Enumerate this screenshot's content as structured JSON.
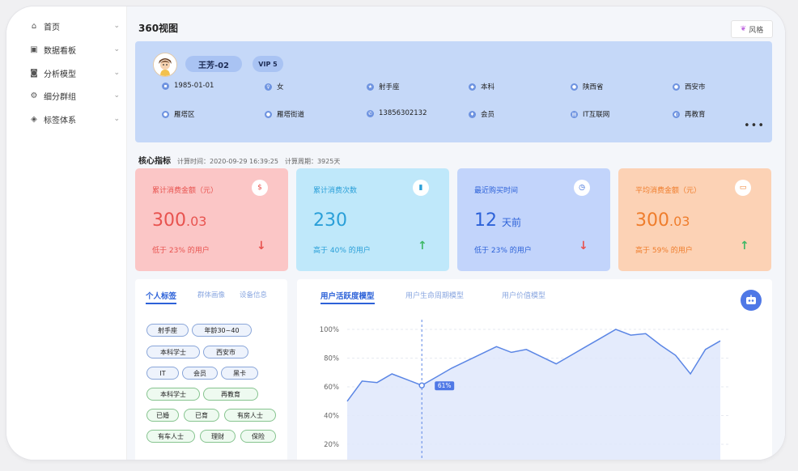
{
  "sidebar": {
    "items": [
      {
        "label": "首页",
        "icon": "home-icon"
      },
      {
        "label": "数据看板",
        "icon": "monitor-icon"
      },
      {
        "label": "分析模型",
        "icon": "model-icon"
      },
      {
        "label": "细分群组",
        "icon": "group-icon"
      },
      {
        "label": "标签体系",
        "icon": "tag-icon"
      }
    ]
  },
  "header": {
    "title": "360视图",
    "style_button": "风格"
  },
  "profile": {
    "name": "王芳-02",
    "vip": "VIP 5",
    "attributes_row1": [
      "1985-01-01",
      "女",
      "射手座",
      "本科",
      "陕西省",
      "西安市"
    ],
    "attributes_row2": [
      "雁塔区",
      "雁塔街道",
      "13856302132",
      "会员",
      "IT互联网",
      "再教育"
    ]
  },
  "core": {
    "title": "核心指标",
    "calc_time": "计算时间：2020-09-29 16:39:25",
    "calc_period": "计算周期：3925天"
  },
  "cards": [
    {
      "label": "累计消费金额（元）",
      "value_int": "300",
      "value_dec": ".03",
      "unit": "",
      "sub": "低于 23% 的用户",
      "direction": "down"
    },
    {
      "label": "累计消费次数",
      "value_int": "230",
      "value_dec": "",
      "unit": "",
      "sub": "高于 40% 的用户",
      "direction": "up"
    },
    {
      "label": "最近购买时间",
      "value_int": "12",
      "value_dec": "",
      "unit": "天前",
      "sub": "低于 23% 的用户",
      "direction": "down"
    },
    {
      "label": "平均消费金额（元）",
      "value_int": "300",
      "value_dec": ".03",
      "unit": "",
      "sub": "高于 59% 的用户",
      "direction": "up"
    }
  ],
  "tags_panel": {
    "tabs": [
      "个人标签",
      "群体画像",
      "设备信息"
    ],
    "tags": [
      [
        "射手座",
        "年龄30~40"
      ],
      [
        "本科学士",
        "西安市"
      ],
      [
        "IT",
        "会员",
        "黑卡"
      ],
      [
        "本科学士",
        "再教育"
      ],
      [
        "已婚",
        "已育",
        "有房人士"
      ],
      [
        "有车人士",
        "理财",
        "保险"
      ]
    ]
  },
  "chart_panel": {
    "tabs": [
      "用户活跃度模型",
      "用户生命周期模型",
      "用户价值模型"
    ]
  },
  "chart_data": {
    "type": "area",
    "ylim": [
      20,
      100
    ],
    "y_ticks": [
      "100%",
      "80%",
      "60%",
      "40%",
      "20%"
    ],
    "values": [
      50,
      64,
      63,
      69,
      65,
      61,
      67,
      73,
      78,
      83,
      88,
      84,
      86,
      81,
      76,
      82,
      88,
      94,
      100,
      96,
      97,
      89,
      82,
      69,
      86,
      92
    ],
    "marker_index": 5,
    "marker_label": "61%",
    "colors": {
      "line": "#5b86e5",
      "fill": "#dfe8fb"
    }
  }
}
